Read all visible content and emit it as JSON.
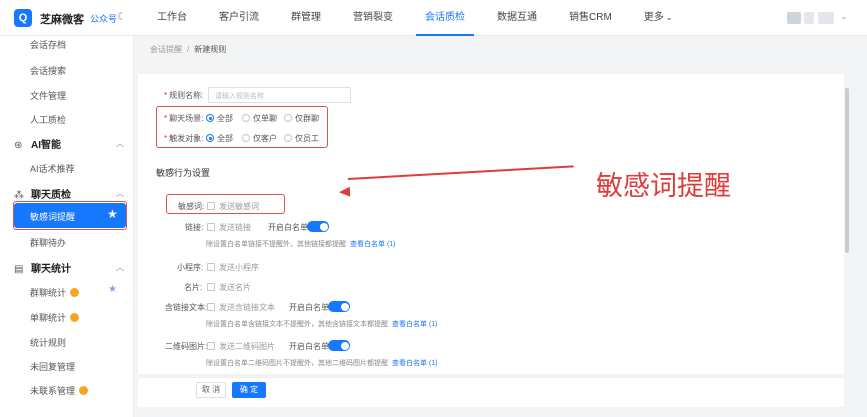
{
  "header": {
    "logo_glyph": "Q",
    "brand": "芝麻微客",
    "account": "公众号",
    "nav": [
      {
        "label": "工作台"
      },
      {
        "label": "客户引流"
      },
      {
        "label": "群管理"
      },
      {
        "label": "营销裂变"
      },
      {
        "label": "会话质检",
        "active": true
      },
      {
        "label": "数据互通"
      },
      {
        "label": "销售CRM"
      },
      {
        "label": "更多"
      }
    ]
  },
  "sidebar": {
    "items_top": [
      "会话存档",
      "会话搜索",
      "文件管理",
      "人工质检"
    ],
    "group_ai": "AI智能",
    "ai_items": [
      "AI话术推荐"
    ],
    "group_qc": "聊天质检",
    "active_item": "敏感词提醒",
    "qc_items": [
      "群聊待办"
    ],
    "group_stats": "聊天统计",
    "stats_items": [
      "群聊统计",
      "单聊统计",
      "统计规则",
      "未回复管理",
      "未联系管理"
    ]
  },
  "breadcrumb": {
    "parent": "会话提醒",
    "separator": "/",
    "current": "新建规则"
  },
  "form": {
    "rule_name_label": "规则名称:",
    "rule_name_placeholder": "请输入规则名称",
    "scene_label": "聊天场景:",
    "scene_options": [
      "全部",
      "仅单聊",
      "仅群聊"
    ],
    "target_label": "触发对象:",
    "target_options": [
      "全部",
      "仅客户",
      "仅员工"
    ],
    "section_title": "敏感行为设置",
    "sensitive_label": "敏感词:",
    "sensitive_option": "发送敏感词",
    "link_label": "链接:",
    "link_option": "发送链接",
    "whitelist_label": "开启白名单",
    "link_hint": "除设置白名单链接不提醒外，其他链接都提醒",
    "view_whitelist": "查看白名单 (1)",
    "mini_label": "小程序:",
    "mini_option": "发送小程序",
    "card_label": "名片:",
    "card_option": "发送名片",
    "linktext_label": "含链接文本:",
    "linktext_option": "发送含链接文本",
    "linktext_hint": "除设置白名单含链接文本不提醒外，其他含链接文本都提醒",
    "qr_label": "二维码图片:",
    "qr_option": "发送二维码图片",
    "qr_hint": "除设置白名单二维码图片不提醒外，其他二维码图片都提醒"
  },
  "annotation": "敏感词提醒",
  "footer": {
    "cancel": "取 消",
    "ok": "确 定"
  },
  "colors": {
    "accent": "#1677ff",
    "annotation": "#e03c3c"
  }
}
